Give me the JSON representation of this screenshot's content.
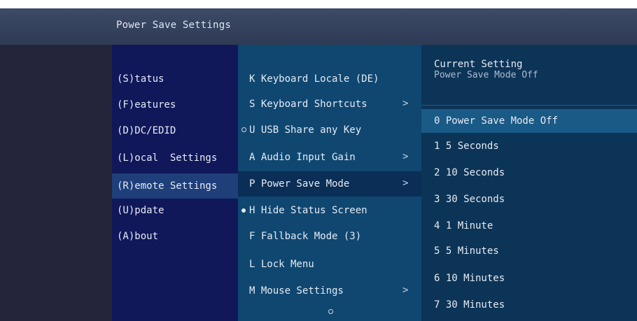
{
  "window": {
    "title": "Power Save Settings"
  },
  "main_menu": {
    "items": [
      {
        "label": "(S)tatus"
      },
      {
        "label": "(F)eatures"
      },
      {
        "label": "(D)DC/EDID"
      },
      {
        "label": "(L)ocal  Settings"
      },
      {
        "label": "(R)emote Settings",
        "selected": true
      },
      {
        "label": "(U)pdate"
      },
      {
        "label": "(A)bout"
      }
    ]
  },
  "submenu": {
    "items": [
      {
        "label": "K Keyboard Locale (DE)"
      },
      {
        "label": "S Keyboard Shortcuts",
        "chevron": ">"
      },
      {
        "label": "U USB Share any Key",
        "bullet": "hollow"
      },
      {
        "label": "A Audio Input Gain",
        "chevron": ">"
      },
      {
        "label": "P Power Save Mode",
        "chevron": ">",
        "selected": true
      },
      {
        "label": "H Hide Status Screen",
        "bullet": "solid"
      },
      {
        "label": "F Fallback Mode (3)"
      },
      {
        "label": "L Lock Menu"
      },
      {
        "label": "M Mouse Settings",
        "chevron": ">"
      }
    ]
  },
  "options_panel": {
    "current_heading": "Current Setting",
    "current_value": "Power Save Mode Off",
    "options": [
      {
        "label": "0 Power Save Mode Off",
        "selected": true
      },
      {
        "label": "1 5 Seconds"
      },
      {
        "label": "2 10 Seconds"
      },
      {
        "label": "3 30 Seconds"
      },
      {
        "label": "4 1 Minute"
      },
      {
        "label": "5 5 Minutes"
      },
      {
        "label": "6 10 Minutes"
      },
      {
        "label": "7 30 Minutes"
      }
    ]
  },
  "colors": {
    "title_bar": "#2f3b55",
    "main_menu_bg": "#10185a",
    "submenu_bg": "#0f4770",
    "options_bg": "#0c3457",
    "highlight": "#1a5a86"
  }
}
